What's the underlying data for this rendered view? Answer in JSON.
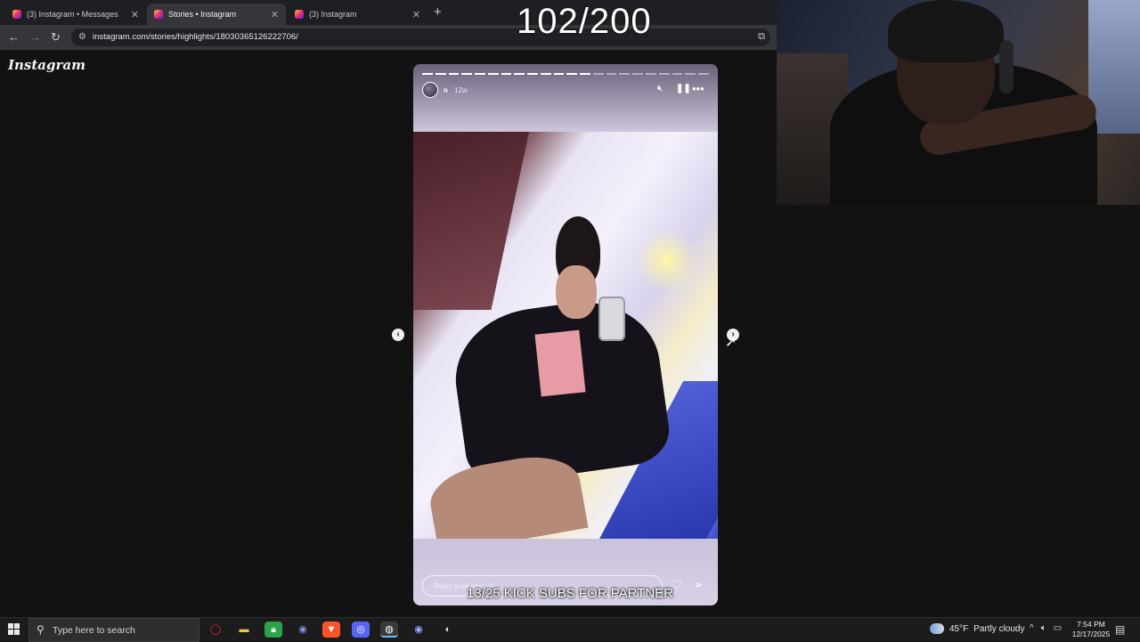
{
  "browser": {
    "tabs": [
      {
        "title": "(3) Instagram • Messages",
        "active": false
      },
      {
        "title": "Stories • Instagram",
        "active": true
      },
      {
        "title": "(3) Instagram",
        "active": false
      }
    ],
    "url": "instagram.com/stories/highlights/18030365126222706/"
  },
  "instagram": {
    "logo": "Instagram",
    "story": {
      "username": "n",
      "time_ago": "12w",
      "progress_total": 22,
      "progress_done": 13,
      "reply_placeholder": "Reply to nii.amauri..."
    }
  },
  "overlay": {
    "counter": "102/200",
    "subs_goal": "13/25 KICK SUBS FOR PARTNER"
  },
  "taskbar": {
    "search_placeholder": "Type here to search",
    "weather_temp": "45°F",
    "weather_desc": "Partly cloudy",
    "time": "7:54 PM",
    "date": "12/17/2025"
  }
}
